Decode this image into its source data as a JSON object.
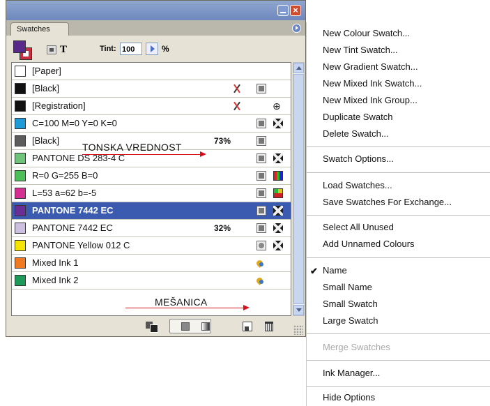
{
  "panel": {
    "tab_label": "Swatches",
    "close_glyph": "×",
    "tint_label": "Tint:",
    "tint_value": "100",
    "tint_unit": "%",
    "text_tool_glyph": "T",
    "swatches": [
      {
        "name": "[Paper]",
        "color": "#ffffff"
      },
      {
        "name": "[Black]",
        "color": "#111111"
      },
      {
        "name": "[Registration]",
        "color": "#111111"
      },
      {
        "name": "C=100 M=0 Y=0 K=0",
        "color": "#1e9ad6"
      },
      {
        "name": "[Black]",
        "color": "#5c5c5c",
        "tint": "73%"
      },
      {
        "name": "PANTONE DS 283-4 C",
        "color": "#6fc37a"
      },
      {
        "name": "R=0 G=255 B=0",
        "color": "#4cbf58"
      },
      {
        "name": "L=53 a=62 b=-5",
        "color": "#d52f92"
      },
      {
        "name": "PANTONE 7442 EC",
        "color": "#6a2c95",
        "selected": true
      },
      {
        "name": "PANTONE 7442 EC",
        "color": "#cdbfe0",
        "tint": "32%"
      },
      {
        "name": "PANTONE Yellow 012 C",
        "color": "#f4e400"
      },
      {
        "name": "Mixed Ink 1",
        "color": "#ef7a22"
      },
      {
        "name": "Mixed Ink 2",
        "color": "#1d9a5a"
      }
    ],
    "icons": [
      "no-edit-icon",
      "process-color-icon",
      "spot-color-icon",
      "cmyk-icon",
      "rgb-icon",
      "lab-icon",
      "registration-target-icon",
      "mixed-ink-icon"
    ],
    "bottom_icons": [
      "show-all-swatches-icon",
      "show-color-swatches-icon",
      "show-gradient-swatches-icon",
      "new-swatch-icon",
      "delete-swatch-icon"
    ],
    "registration_glyph": "⊕"
  },
  "annotations": {
    "tonal_value": "TONSKA VREDNOST",
    "mixture": "MEŠANICA",
    "arrow_color": "#d6101c"
  },
  "menu": {
    "check_glyph": "✔",
    "items": [
      {
        "label": "New Colour Swatch..."
      },
      {
        "label": "New Tint Swatch..."
      },
      {
        "label": "New Gradient Swatch..."
      },
      {
        "label": "New Mixed Ink Swatch..."
      },
      {
        "label": "New Mixed Ink Group..."
      },
      {
        "label": "Duplicate Swatch"
      },
      {
        "label": "Delete Swatch..."
      },
      {
        "label": "Swatch Options..."
      },
      {
        "label": "Load Swatches..."
      },
      {
        "label": "Save Swatches For Exchange..."
      },
      {
        "label": "Select All Unused"
      },
      {
        "label": "Add Unnamed Colours"
      },
      {
        "label": "Name",
        "checked": true
      },
      {
        "label": "Small Name"
      },
      {
        "label": "Small Swatch"
      },
      {
        "label": "Large Swatch"
      },
      {
        "label": "Merge Swatches",
        "disabled": true
      },
      {
        "label": "Ink Manager..."
      },
      {
        "label": "Hide Options"
      }
    ]
  },
  "colors": {
    "titlebar": "#7b93c6",
    "selection": "#3b5bb0",
    "panel_bg": "#e6e3d6"
  }
}
